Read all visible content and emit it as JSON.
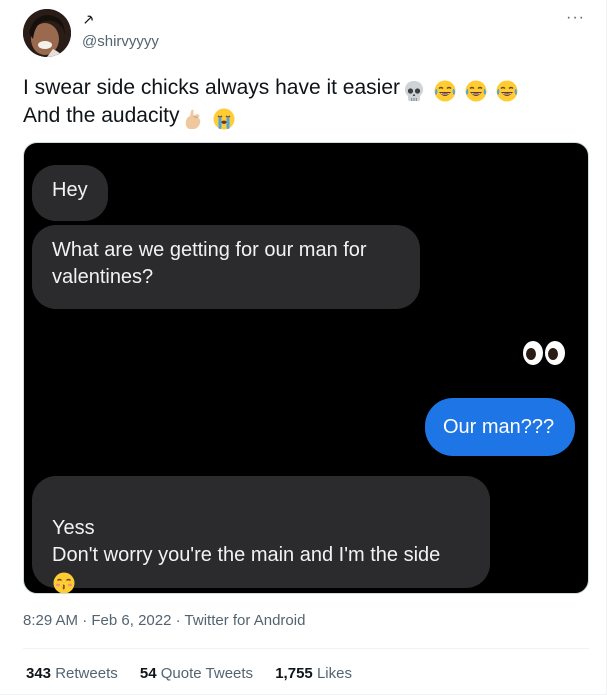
{
  "author": {
    "display_name": "⸕",
    "handle": "@shirvyyyy"
  },
  "tweet": {
    "line1": "I swear side chicks always have it easier",
    "line1_emojis": [
      "skull-emoji",
      "joy-emoji",
      "joy-emoji",
      "joy-emoji"
    ],
    "line2": "And the audacity",
    "line2_emojis": [
      "pinching-hand-emoji",
      "loudly-crying-emoji"
    ]
  },
  "chat": {
    "messages": [
      {
        "side": "left",
        "text": "Hey"
      },
      {
        "side": "left",
        "text": "What are we getting for our man for\nvalentines?"
      },
      {
        "side": "right",
        "text": "Our man???"
      },
      {
        "side": "left",
        "text": "Yess\nDon't worry you're the main and I'm the side"
      }
    ],
    "reaction_icon": "eyes-emoji",
    "trailing_emoji": "kissing-emoji",
    "colors": {
      "background": "#000000",
      "incoming": "#2b2b2d",
      "outgoing": "#1d75e6"
    }
  },
  "meta": {
    "time": "8:29 AM",
    "date": "Feb 6, 2022",
    "source": "Twitter for Android",
    "separator": "·"
  },
  "stats": {
    "retweets_count": "343",
    "retweets_label": "Retweets",
    "quotes_count": "54",
    "quotes_label": "Quote Tweets",
    "likes_count": "1,755",
    "likes_label": "Likes"
  },
  "more_label": "···"
}
